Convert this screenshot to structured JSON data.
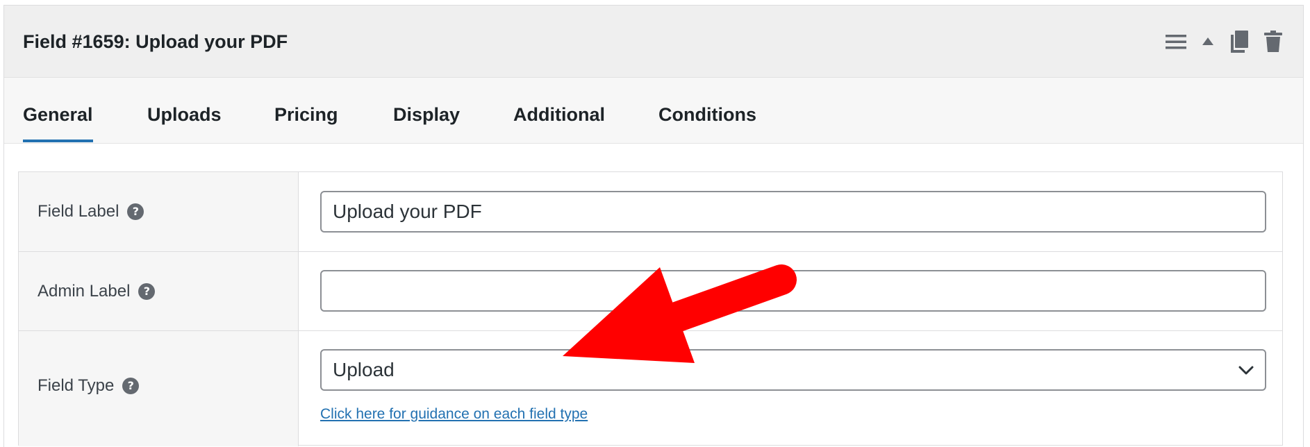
{
  "header": {
    "title": "Field #1659: Upload your PDF",
    "actions": [
      {
        "icon": "menu-icon"
      },
      {
        "icon": "collapse-up-icon"
      },
      {
        "icon": "duplicate-icon"
      },
      {
        "icon": "trash-icon"
      }
    ]
  },
  "tabs": [
    {
      "label": "General",
      "active": true
    },
    {
      "label": "Uploads",
      "active": false
    },
    {
      "label": "Pricing",
      "active": false
    },
    {
      "label": "Display",
      "active": false
    },
    {
      "label": "Additional",
      "active": false
    },
    {
      "label": "Conditions",
      "active": false
    }
  ],
  "form": {
    "field_label": {
      "label": "Field Label",
      "value": "Upload your PDF"
    },
    "admin_label": {
      "label": "Admin Label",
      "value": ""
    },
    "field_type": {
      "label": "Field Type",
      "selected": "Upload",
      "guidance_link": "Click here for guidance on each field type"
    }
  },
  "colors": {
    "accent": "#2271b1",
    "annotation_arrow": "#ff0000",
    "header_bg": "#efefef",
    "icon_gray": "#646970"
  }
}
